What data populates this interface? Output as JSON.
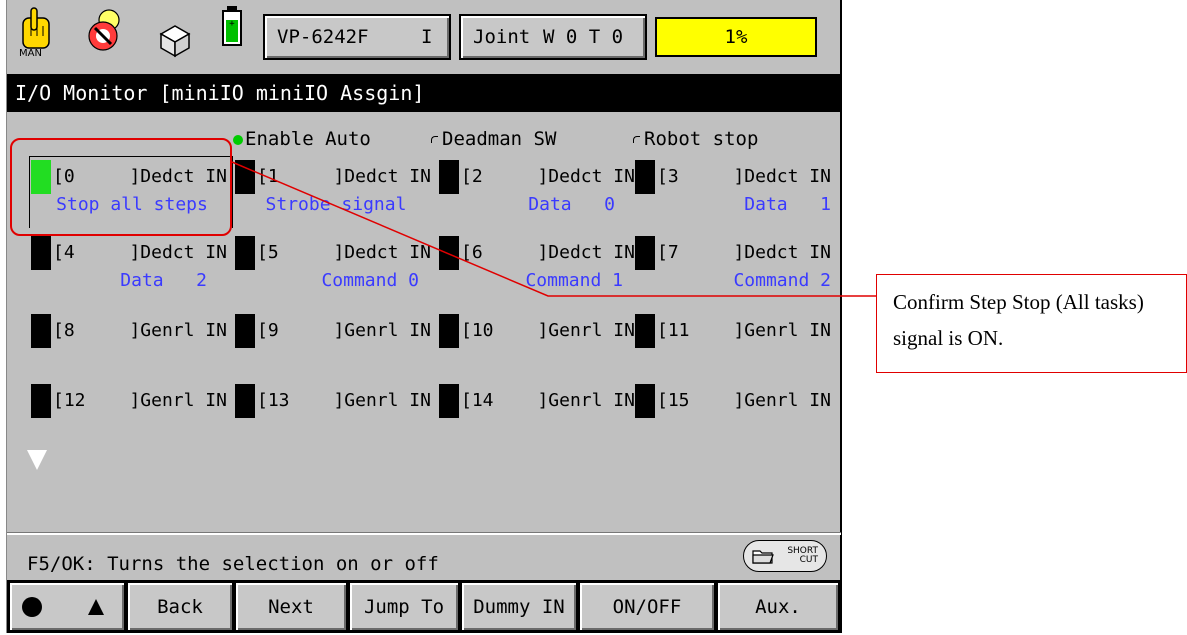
{
  "topbar": {
    "icons": [
      "hand-icon",
      "no-entry-icon",
      "cube-icon",
      "battery-icon"
    ],
    "mode_label": "MAN",
    "robot_model": "VP-6242F",
    "robot_index": "I",
    "coord_mode": "Joint",
    "work_tool": "W 0 T 0",
    "speed": "1%",
    "speed_color": "#ffff00"
  },
  "title": "I/O Monitor [miniIO miniIO Assgin]",
  "status": {
    "enable_auto": "Enable Auto",
    "deadman_sw": "Deadman SW",
    "robot_stop": "Robot stop"
  },
  "io_rows": [
    [
      {
        "port": "[0",
        "type": "]Dedct IN",
        "desc": "Stop all steps",
        "state": "on"
      },
      {
        "port": "[1",
        "type": "]Dedct IN",
        "desc": "Strobe signal",
        "state": "off"
      },
      {
        "port": "[2",
        "type": "]Dedct IN",
        "desc": "Data   0",
        "state": "off"
      },
      {
        "port": "[3",
        "type": "]Dedct IN",
        "desc": "Data   1",
        "state": "off"
      }
    ],
    [
      {
        "port": "[4",
        "type": "]Dedct IN",
        "desc": "Data   2",
        "state": "off"
      },
      {
        "port": "[5",
        "type": "]Dedct IN",
        "desc": "Command 0",
        "state": "off"
      },
      {
        "port": "[6",
        "type": "]Dedct IN",
        "desc": "Command 1",
        "state": "off"
      },
      {
        "port": "[7",
        "type": "]Dedct IN",
        "desc": "Command 2",
        "state": "off"
      }
    ],
    [
      {
        "port": "[8",
        "type": "]Genrl IN",
        "desc": "",
        "state": "off"
      },
      {
        "port": "[9",
        "type": "]Genrl IN",
        "desc": "",
        "state": "off"
      },
      {
        "port": "[10",
        "type": "]Genrl IN",
        "desc": "",
        "state": "off"
      },
      {
        "port": "[11",
        "type": "]Genrl IN",
        "desc": "",
        "state": "off"
      }
    ],
    [
      {
        "port": "[12",
        "type": "]Genrl IN",
        "desc": "",
        "state": "off"
      },
      {
        "port": "[13",
        "type": "]Genrl IN",
        "desc": "",
        "state": "off"
      },
      {
        "port": "[14",
        "type": "]Genrl IN",
        "desc": "",
        "state": "off"
      },
      {
        "port": "[15",
        "type": "]Genrl IN",
        "desc": "",
        "state": "off"
      }
    ]
  ],
  "hint": "F5/OK: Turns the selection on or off",
  "shortcut": {
    "line1": "SHORT",
    "line2": "CUT"
  },
  "function_keys": [
    "Back",
    "Next",
    "Jump To",
    "Dummy IN",
    "ON/OFF",
    "Aux."
  ],
  "callout": "Confirm Step  Stop (All tasks) signal is ON."
}
